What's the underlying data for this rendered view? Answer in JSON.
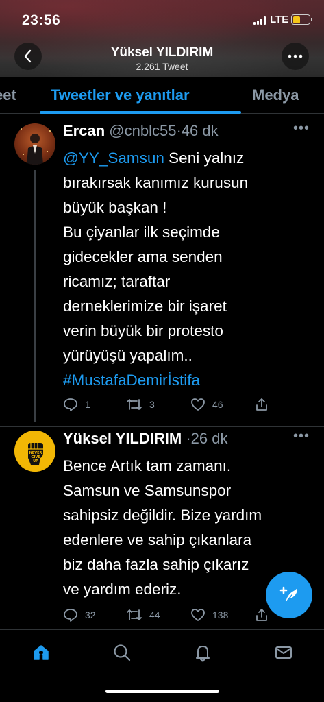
{
  "status_bar": {
    "time": "23:56",
    "network": "LTE",
    "battery_color": "#f5c518"
  },
  "header": {
    "title": "Yüksel YILDIRIM",
    "tweet_count": "2.261 Tweet",
    "back_icon": "chevron-left-icon",
    "more_icon": "more-horizontal-icon"
  },
  "tabs": [
    {
      "label": "eet",
      "active": false
    },
    {
      "label": "Tweetler ve yanıtlar",
      "active": true
    },
    {
      "label": "Medya",
      "active": false
    }
  ],
  "colors": {
    "accent": "#1d9bf0",
    "muted": "#8b98a5",
    "background": "#000000"
  },
  "tweets": [
    {
      "name": "Ercan",
      "handle": "@cnblc55",
      "separator": "·",
      "time": "46 dk",
      "lines": [
        {
          "mention": "@YY_Samsun",
          "text": " Seni yalnız"
        },
        {
          "text": "bırakırsak kanımız kurusun"
        },
        {
          "text": "büyük başkan !"
        },
        {
          "text": "Bu çiyanlar ilk seçimde"
        },
        {
          "text": "gidecekler ama senden"
        },
        {
          "text": "ricamız; taraftar"
        },
        {
          "text": "derneklerimize bir işaret"
        },
        {
          "text": "verin büyük bir protesto"
        },
        {
          "text": "yürüyüşü yapalım.."
        }
      ],
      "hashtag": "#MustafaDemirİstifa",
      "replies": "1",
      "retweets": "3",
      "likes": "46"
    },
    {
      "name": "Yüksel YILDIRIM",
      "handle": "",
      "separator": "·",
      "time": "26 dk",
      "avatar_text": [
        "NEVER",
        "GIVE",
        "UP"
      ],
      "lines": [
        {
          "text": "Bence Artık tam zamanı."
        },
        {
          "text": "Samsun ve Samsunspor"
        },
        {
          "text": "sahipsiz değildir. Bize yardım"
        },
        {
          "text": "edenlere ve sahip çıkanlara"
        },
        {
          "text": "biz daha fazla sahip çıkarız"
        },
        {
          "text": "ve yardım ederiz."
        }
      ],
      "replies": "32",
      "retweets": "44",
      "likes": "138"
    }
  ],
  "fab": {
    "icon": "compose-tweet-icon"
  },
  "bottom_nav": [
    {
      "icon": "home-icon",
      "active": true
    },
    {
      "icon": "search-icon",
      "active": false
    },
    {
      "icon": "notifications-icon",
      "active": false
    },
    {
      "icon": "messages-icon",
      "active": false
    }
  ]
}
